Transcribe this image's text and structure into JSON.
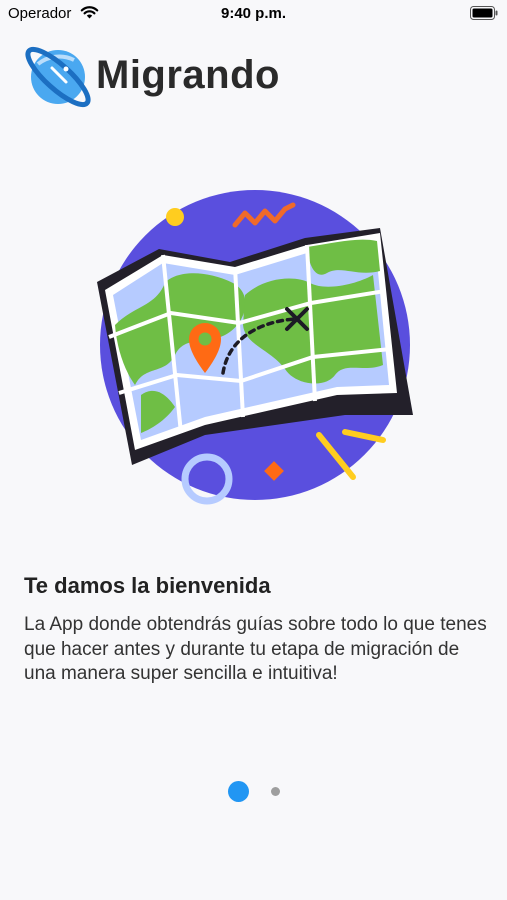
{
  "status_bar": {
    "carrier": "Operador",
    "time": "9:40 p.m."
  },
  "header": {
    "app_name": "Migrando"
  },
  "onboarding": {
    "title": "Te damos la bienvenida",
    "body": "La App donde obtendrás guías sobre todo lo que tenes que hacer antes y durante tu etapa de migración de una manera super sencilla e intuitiva!"
  },
  "pager": {
    "page_count": 2,
    "current_page": 1
  },
  "colors": {
    "accent": "#2196f3",
    "map_circle": "#5a4fde",
    "map_land": "#6fbe45",
    "map_water": "#b6cbff",
    "marker": "#ff6a14"
  },
  "icons": {
    "logo": "planet-icon",
    "illustration": "map-illustration",
    "wifi": "wifi-icon",
    "battery": "battery-icon"
  }
}
